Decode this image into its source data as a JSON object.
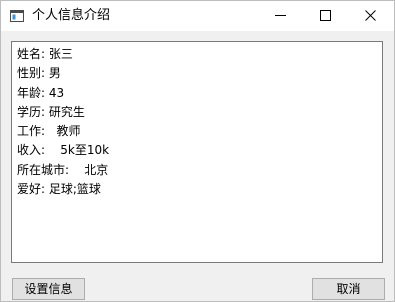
{
  "window": {
    "title": "个人信息介绍",
    "icon": "window-app-icon",
    "controls": {
      "minimize_icon": "minimize-icon",
      "maximize_icon": "maximize-icon",
      "close_icon": "close-icon"
    }
  },
  "info": {
    "lines": [
      "姓名: 张三",
      "性别: 男",
      "年龄: 43",
      "学历: 研究生",
      "工作:   教师",
      "收入:    5k至10k",
      "所在城市:    北京",
      "爱好: 足球;篮球"
    ]
  },
  "buttons": {
    "set_info_label": "设置信息",
    "cancel_label": "取消"
  },
  "colors": {
    "window_bg": "#f0f0f0",
    "titlebar_bg": "#ffffff",
    "text_box_border": "#7a7a7a",
    "button_bg": "#e1e1e1",
    "button_border": "#adadad"
  }
}
